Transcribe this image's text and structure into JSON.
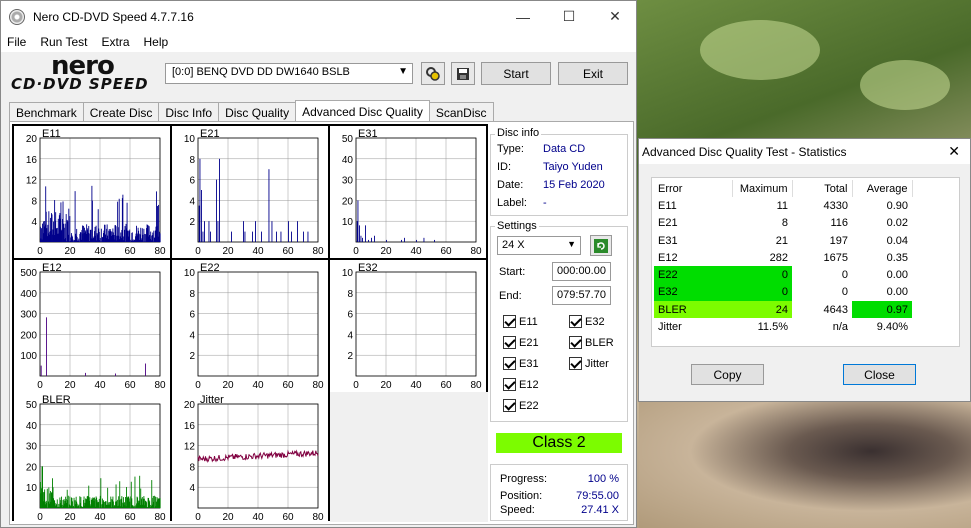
{
  "window": {
    "title": "Nero CD-DVD Speed 4.7.7.16",
    "minimize_glyph": "—",
    "maximize_glyph": "☐",
    "close_glyph": "✕"
  },
  "menu": [
    "File",
    "Run Test",
    "Extra",
    "Help"
  ],
  "logo": {
    "top": "nero",
    "bottom": "CD·DVD SPEED"
  },
  "drive": {
    "value": "[0:0]   BENQ DVD DD DW1640 BSLB"
  },
  "buttons": {
    "start": "Start",
    "exit": "Exit"
  },
  "tabs": [
    "Benchmark",
    "Create Disc",
    "Disc Info",
    "Disc Quality",
    "Advanced Disc Quality",
    "ScanDisc"
  ],
  "active_tab": "Advanced Disc Quality",
  "disc_info": {
    "title": "Disc info",
    "type_label": "Type:",
    "type": "Data CD",
    "id_label": "ID:",
    "id": "Taiyo Yuden",
    "date_label": "Date:",
    "date": "15 Feb 2020",
    "label_label": "Label:",
    "label": "-"
  },
  "settings": {
    "title": "Settings",
    "speed": "24 X",
    "start_label": "Start:",
    "start": "000:00.00",
    "end_label": "End:",
    "end": "079:57.70",
    "checkboxes": [
      "E11",
      "E32",
      "E21",
      "BLER",
      "E31",
      "Jitter",
      "E12",
      "E22"
    ]
  },
  "class_label": "Class 2",
  "progress": {
    "progress_label": "Progress:",
    "progress": "100 %",
    "position_label": "Position:",
    "position": "79:55.00",
    "speed_label": "Speed:",
    "speed": "27.41 X"
  },
  "chart_data": [
    {
      "type": "bar",
      "name": "E11",
      "x": [
        0,
        20,
        40,
        60,
        80
      ],
      "y_ticks": [
        4,
        8,
        12,
        16,
        20
      ],
      "ylim": [
        0,
        20
      ],
      "xlim": [
        0,
        80
      ],
      "color": "#00008b"
    },
    {
      "type": "bar",
      "name": "E21",
      "x": [
        0,
        20,
        40,
        60,
        80
      ],
      "y_ticks": [
        2,
        4,
        6,
        8,
        10
      ],
      "ylim": [
        0,
        10
      ],
      "xlim": [
        0,
        80
      ],
      "color": "#00008b"
    },
    {
      "type": "bar",
      "name": "E31",
      "x": [
        0,
        20,
        40,
        60,
        80
      ],
      "y_ticks": [
        10,
        20,
        30,
        40,
        50
      ],
      "ylim": [
        0,
        50
      ],
      "xlim": [
        0,
        80
      ],
      "color": "#00008b"
    },
    {
      "type": "bar",
      "name": "E12",
      "x": [
        0,
        20,
        40,
        60,
        80
      ],
      "y_ticks": [
        100,
        200,
        300,
        400,
        500
      ],
      "ylim": [
        0,
        500
      ],
      "xlim": [
        0,
        80
      ],
      "color": "#4b0082"
    },
    {
      "type": "bar",
      "name": "E22",
      "x": [
        0,
        20,
        40,
        60,
        80
      ],
      "y_ticks": [
        2,
        4,
        6,
        8,
        10
      ],
      "ylim": [
        0,
        10
      ],
      "xlim": [
        0,
        80
      ],
      "color": "#4b0082"
    },
    {
      "type": "bar",
      "name": "E32",
      "x": [
        0,
        20,
        40,
        60,
        80
      ],
      "y_ticks": [
        2,
        4,
        6,
        8,
        10
      ],
      "ylim": [
        0,
        10
      ],
      "xlim": [
        0,
        80
      ],
      "color": "#4b0082"
    },
    {
      "type": "bar",
      "name": "BLER",
      "x": [
        0,
        20,
        40,
        60,
        80
      ],
      "y_ticks": [
        10,
        20,
        30,
        40,
        50
      ],
      "ylim": [
        0,
        50
      ],
      "xlim": [
        0,
        80
      ],
      "color": "#008000"
    },
    {
      "type": "line",
      "name": "Jitter",
      "x": [
        0,
        20,
        40,
        60,
        80
      ],
      "y_ticks": [
        4,
        8,
        12,
        16,
        20
      ],
      "ylim": [
        0,
        20
      ],
      "xlim": [
        0,
        80
      ],
      "color": "#800040"
    }
  ],
  "stats": {
    "title": "Advanced Disc Quality Test - Statistics",
    "headers": [
      "Error",
      "Maximum",
      "Total",
      "Average"
    ],
    "rows": [
      [
        "E11",
        "11",
        "4330",
        "0.90"
      ],
      [
        "E21",
        "8",
        "116",
        "0.02"
      ],
      [
        "E31",
        "21",
        "197",
        "0.04"
      ],
      [
        "E12",
        "282",
        "1675",
        "0.35"
      ],
      [
        "E22",
        "0",
        "0",
        "0.00"
      ],
      [
        "E32",
        "0",
        "0",
        "0.00"
      ],
      [
        "BLER",
        "24",
        "4643",
        "0.97"
      ],
      [
        "Jitter",
        "11.5%",
        "n/a",
        "9.40%"
      ]
    ],
    "copy_label": "Copy",
    "close_label": "Close",
    "close_glyph": "✕"
  }
}
